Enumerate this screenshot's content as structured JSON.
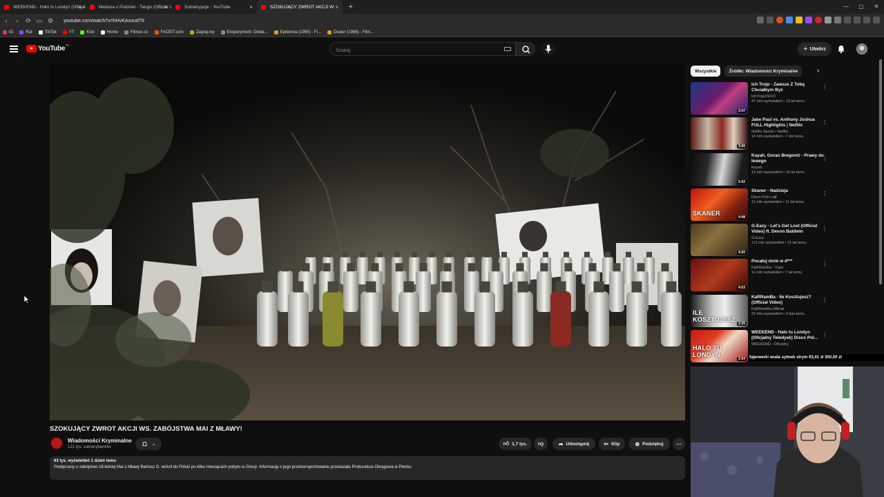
{
  "browser": {
    "tabs": [
      {
        "title": "WEEKEND - Halo tu Londyn (Oficjaln",
        "active": false
      },
      {
        "title": "Medusa x Pudzian - Tango (Official V",
        "active": false
      },
      {
        "title": "Subskrypcje - YouTube",
        "active": false
      },
      {
        "title": "SZOKUJĄCY ZWROT AKCJI W",
        "active": true
      }
    ],
    "url": "youtube.com/watch?v=hHvKAxoudT8",
    "bookmarks": [
      {
        "label": "IG",
        "color": "#e1306c"
      },
      {
        "label": "Rat",
        "color": "#9146ff"
      },
      {
        "label": "TikTok",
        "color": "#ffffff"
      },
      {
        "label": "YT",
        "color": "#ff0000"
      },
      {
        "label": "Kick",
        "color": "#53fc18"
      },
      {
        "label": "Home",
        "color": "#ffffff"
      },
      {
        "label": "Filman.cc",
        "color": "#888888"
      },
      {
        "label": "FACEIT.com",
        "color": "#ff5500"
      },
      {
        "label": "Zagraj.my",
        "color": "#d4a017"
      },
      {
        "label": "Eksperyment: Odsła...",
        "color": "#888888"
      },
      {
        "label": "Epidemia (1995) - Fi...",
        "color": "#d4a017"
      },
      {
        "label": "Dealer (1996) - Film...",
        "color": "#d4a017"
      }
    ]
  },
  "youtube": {
    "logo_text": "YouTube",
    "logo_country": "PL",
    "search_placeholder": "Szukaj",
    "create_label": "Utwórz"
  },
  "video": {
    "title": "SZOKUJĄCY ZWROT AKCJI WS. ZABÓJSTWA MAI Z MŁAWY!",
    "channel": "Wiadomości Kryminalne",
    "subscribers": "121 tys. subskrybentów",
    "likes": "1,7 tys.",
    "share_label": "Udostępnij",
    "clip_label": "Klip",
    "thanks_label": "Podziękuj",
    "views_date": "63 tys. wyświetleń  1 dzień temu",
    "description": "Podejrzany o zabójstwo 16-letniej Mai z Mławy Bartosz G. wrócił do Polski po kilku miesiącach pobytu w Grecji. Informację o jego przetransportowaniu przekazała Prokuratura Okręgowa w Płocku"
  },
  "chips": [
    {
      "label": "Wszystkie",
      "active": true
    },
    {
      "label": "Źródło: Wiadomości Kryminalne",
      "active": false
    }
  ],
  "recommendations": [
    {
      "title": "Ich Troje - Zawsze Z Tobą Chciałbym Być",
      "channel": "IchTrojeVEVO",
      "stats": "47 mln wyświetleń • 13 lat temu",
      "duration": "3:47",
      "thumb_text": "",
      "thumb_bg": "linear-gradient(135deg,#1a3a8a 0%,#6a1a6a 45%,#c04080 60%,#20206a 100%)"
    },
    {
      "title": "Jake Paul vs. Anthony Joshua FULL Highlights | Netflix",
      "channel": "Netflix Sports • Netflix",
      "stats": "14 mln wyświetleń • 7 dni temu",
      "duration": "3:00",
      "thumb_text": "",
      "thumb_bg": "linear-gradient(90deg,#5a1a14 0%,#c8b8a8 30%,#8a2a20 55%,#e0d0c0 75%,#3a1010 100%)"
    },
    {
      "title": "Kayah, Goran Bregović - Prawy do lewego",
      "channel": "Kayah",
      "stats": "13 mln wyświetleń • 16 lat temu",
      "duration": "5:02",
      "thumb_text": "",
      "thumb_bg": "linear-gradient(100deg,#0a0a0a 0%,#2a2a2a 30%,#d8d8d8 55%,#1a1a1a 85%)"
    },
    {
      "title": "Skaner - Nadzieja",
      "channel": "Disco Polo Lajf",
      "stats": "11 mln wyświetleń • 11 lat temu",
      "duration": "4:48",
      "thumb_text": "SKANER",
      "thumb_bg": "linear-gradient(135deg,#c01010 0%,#f06020 40%,#802010 70%,#3a0a0a 100%)"
    },
    {
      "title": "G-Eazy - Let's Get Lost (Official Video) ft. Devon Baldwin",
      "channel": "G-Eazy",
      "stats": "112 mln wyświetleń • 11 lat temu",
      "duration": "4:20",
      "thumb_text": "",
      "thumb_bg": "linear-gradient(135deg,#4a3a20 0%,#8a7040 40%,#2a2010 100%)"
    },
    {
      "title": "Pocałuj mnie w d***",
      "channel": "KaRRamBa - Topic",
      "stats": "11 mln wyświetleń • 7 lat temu",
      "duration": "4:03",
      "thumb_text": "",
      "thumb_bg": "linear-gradient(135deg,#6a1010 0%,#b03a1a 50%,#3a0808 100%)"
    },
    {
      "title": "KaRRamBa - Ile Kosztujesz? (Official Video)",
      "channel": "KaRRamBa Official",
      "stats": "23 mln wyświetleń • 3 lata temu",
      "duration": "3:26",
      "thumb_text": "ILE KOSZTUJESZ",
      "thumb_bg": "linear-gradient(90deg,#1a1a1a 0%,#c8c8c8 40%,#f0f0f0 60%,#5a5a5a 100%)"
    },
    {
      "title": "WEEKEND - Halo tu Londyn (Oficjalny Teledysk) Disco Pol...",
      "channel": "WEEKEND - Oficjalny",
      "stats": "",
      "duration": "2:54",
      "thumb_text": "HALO TU LONDYN",
      "thumb_bg": "linear-gradient(135deg,#c01818 0%,#e04020 35%,#f0d8c8 55%,#a01010 100%)"
    }
  ],
  "ticker": "fajerwerki wuda sylwek strym  93,41 zł  300,00 zł"
}
